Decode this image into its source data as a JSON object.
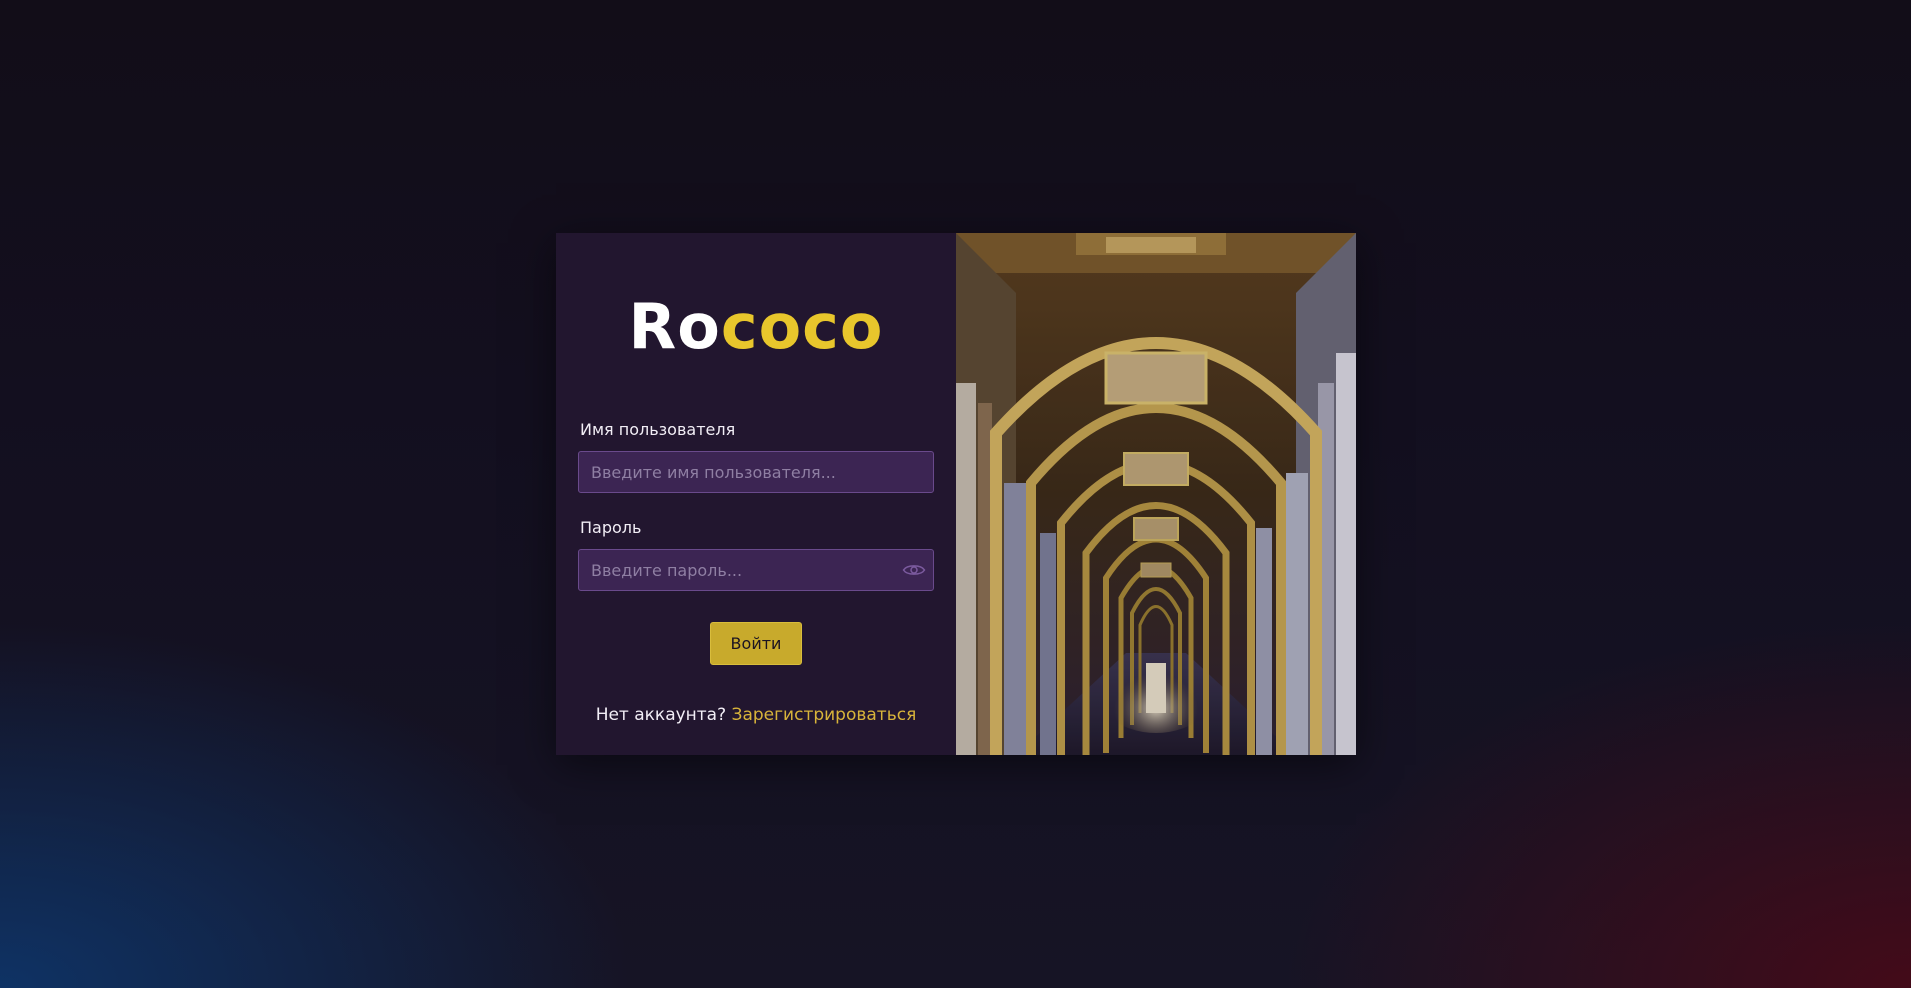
{
  "brand": {
    "logo_part1": "Ro",
    "logo_part2": "coco"
  },
  "form": {
    "username_label": "Имя пользователя",
    "username_placeholder": "Введите имя пользователя...",
    "username_value": "",
    "password_label": "Пароль",
    "password_placeholder": "Введите пароль...",
    "password_value": "",
    "password_toggle_icon": "eye-icon",
    "submit_label": "Войти"
  },
  "footer": {
    "prompt": "Нет аккаунта?",
    "register_link": "Зарегистрироваться"
  },
  "colors": {
    "accent": "#e8c62c",
    "button": "#c8aa2c",
    "panel": "#22162f",
    "input_bg": "#3c2553",
    "link": "#d8b43a"
  }
}
